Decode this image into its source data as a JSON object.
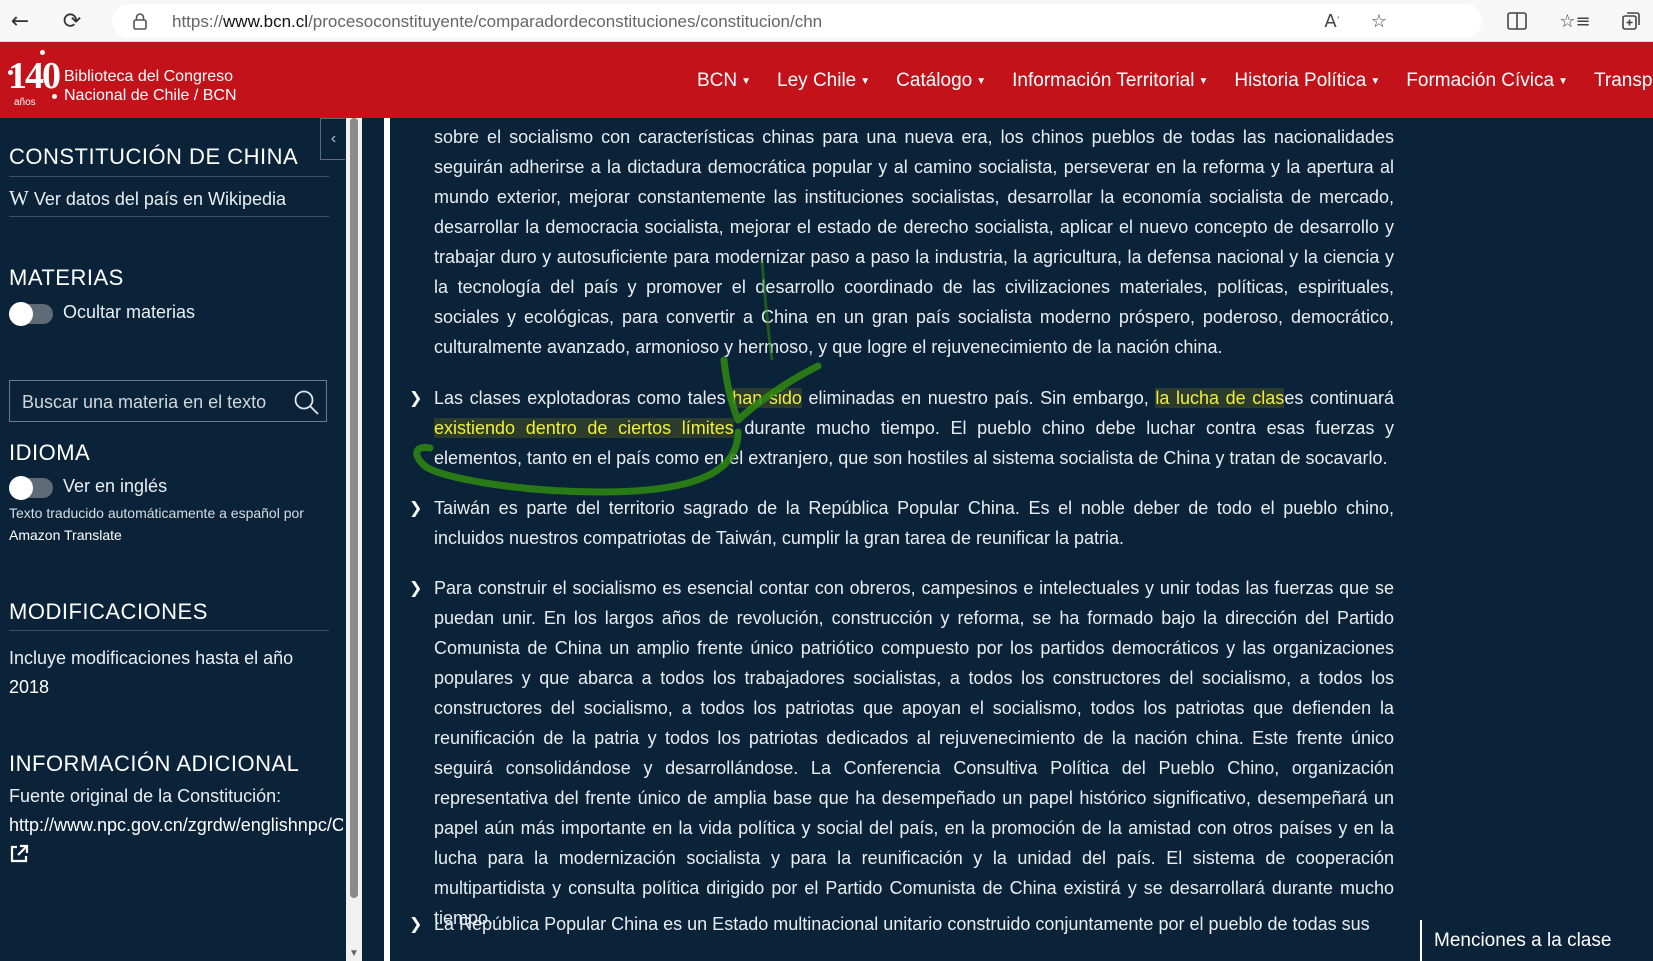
{
  "browser": {
    "url_prefix": "https://",
    "url_host": "www.bcn.cl",
    "url_path": "/procesoconstituyente/comparadordeconstituciones/constitucion/chn",
    "back_icon": "arrow-left-icon",
    "reload_icon": "reload-icon",
    "lock_icon": "lock-icon",
    "toolbar_icons": [
      "read-aloud-icon",
      "favorite-star-icon",
      "split-screen-icon",
      "favorites-icon",
      "collections-icon"
    ]
  },
  "header": {
    "logo_number": "140",
    "logo_years": "años",
    "logo_line1": "Biblioteca del Congreso",
    "logo_line2": "Nacional de Chile / BCN",
    "brand_color": "#c4121a",
    "nav": [
      {
        "label": "BCN"
      },
      {
        "label": "Ley Chile"
      },
      {
        "label": "Catálogo"
      },
      {
        "label": "Información Territorial"
      },
      {
        "label": "Historia Política"
      },
      {
        "label": "Formación Cívica"
      },
      {
        "label": "Transparencia"
      }
    ]
  },
  "sidebar": {
    "title": "CONSTITUCIÓN DE CHINA",
    "wiki_glyph": "W",
    "wiki_link": "Ver datos del país en Wikipedia",
    "materias_heading": "MATERIAS",
    "ocultar_label": "Ocultar materias",
    "search_placeholder": "Buscar una materia en el texto",
    "idioma_heading": "IDIOMA",
    "ingles_label": "Ver en inglés",
    "translate_note": "Texto traducido automáticamente a español por",
    "translate_service": "Amazon Translate",
    "modificaciones_heading": "MODIFICACIONES",
    "modificaciones_text": "Incluye modificaciones hasta el año",
    "modificaciones_year": "2018",
    "info_heading": "INFORMACIÓN ADICIONAL",
    "fuente_label": "Fuente original de la Constitución:",
    "fuente_url": "http://www.npc.gov.cn/zgrdw/englishnpc/C",
    "external_icon": "external-link-icon",
    "collapse_icon": "chevron-left-icon"
  },
  "content": {
    "p1": "sobre el socialismo con características chinas para una nueva era, los chinos pueblos de todas las nacionalidades seguirán adherirse a la dictadura democrática popular y al camino socialista, perseverar en la reforma y la apertura al mundo exterior, mejorar constantemente las instituciones socialistas, desarrollar la economía socialista de mercado, desarrollar la democracia socialista, mejorar el estado de derecho socialista, aplicar el nuevo concepto de desarrollo y trabajar duro y autosuficiente para modernizar paso a paso la industria, la agricultura, la defensa nacional y la ciencia y la tecnología del país y promover el desarrollo coordinado de las civilizaciones materiales, políticas, espirituales, sociales y ecológicas, para convertir a China en un gran país socialista moderno próspero, poderoso, democrático, culturalmente avanzado, armonioso y hermoso, y que logre el rejuvenecimiento de la nación china.",
    "p2_a": "Las clases explotadoras como tales ",
    "p2_hl1": "han sido",
    "p2_b": " eliminadas en nuestro país. Sin embargo, ",
    "p2_hl2": "la lucha de clas",
    "p2_c": "es continuará ",
    "p2_hl3": "existiendo dentro de ciertos límites",
    "p2_d": " durante mucho tiempo. El pueblo chino debe luchar contra esas fuerzas y elementos, tanto en el país como en el extranjero, que son hostiles al sistema socialista de China y tratan de socavarlo.",
    "p3": "Taiwán es parte del territorio sagrado de la República Popular China. Es el noble deber de todo el pueblo chino, incluidos nuestros compatriotas de Taiwán, cumplir la gran tarea de reunificar la patria.",
    "p4": "Para construir el socialismo es esencial contar con obreros, campesinos e intelectuales y unir todas las fuerzas que se puedan unir. En los largos años de revolución, construcción y reforma, se ha formado bajo la dirección del Partido Comunista de China un amplio frente único patriótico compuesto por los partidos democráticos y las organizaciones populares y que abarca a todos los trabajadores socialistas, a todos los constructores del socialismo, a todos los constructores del socialismo, a todos los patriotas que apoyan el socialismo, todos los patriotas que defienden la reunificación de la patria y todos los patriotas dedicados al rejuvenecimiento de la nación china. Este frente único seguirá consolidándose y desarrollándose. La Conferencia Consultiva Política del Pueblo Chino, organización representativa del frente único de amplia base que ha desempeñado un papel histórico significativo, desempeñará un papel aún más importante en la vida política y social del país, en la promoción de la amistad con otros países y en la lucha para la modernización socialista y para la reunificación y la unidad del país. El sistema de cooperación multipartidista y consulta política dirigido por el Partido Comunista de China existirá y se desarrollará durante mucho tiempo.",
    "p5": "La República Popular China es un Estado multinacional unitario construido conjuntamente por el pueblo de todas sus",
    "chevron_icon": "chevron-right-icon",
    "highlight_color": "#f2ef3a",
    "annotation_color": "#2f8a12"
  },
  "mentions_button": "Menciones a la clase"
}
